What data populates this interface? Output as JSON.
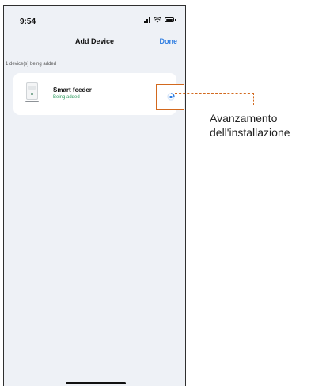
{
  "status_bar": {
    "time": "9:54",
    "icons": [
      "signal-icon",
      "wifi-icon",
      "battery-icon"
    ]
  },
  "header": {
    "title": "Add Device",
    "done_label": "Done"
  },
  "section": {
    "label": "1 device(s) being added"
  },
  "device": {
    "name": "Smart feeder",
    "status": "Being added",
    "icon": "smart-feeder-image",
    "progress_icon": "loading-spinner-icon"
  },
  "annotation": {
    "line1": "Avanzamento",
    "line2": "dell'installazione"
  },
  "colors": {
    "accent": "#2f7de1",
    "status_green": "#2e9b5f",
    "callout": "#d2691e",
    "background": "#eef1f6"
  }
}
